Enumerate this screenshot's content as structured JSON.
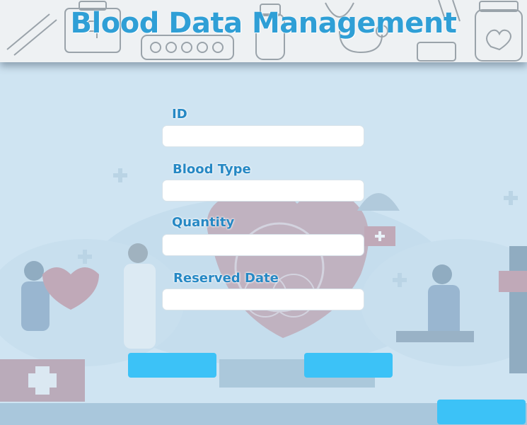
{
  "header": {
    "title": "Blood Data Management"
  },
  "form": {
    "fields": [
      {
        "label": "ID",
        "value": "",
        "placeholder": ""
      },
      {
        "label": "Blood Type",
        "value": "",
        "placeholder": ""
      },
      {
        "label": "Quantity",
        "value": "",
        "placeholder": ""
      },
      {
        "label": "Reserved Date",
        "value": "",
        "placeholder": ""
      }
    ]
  },
  "buttons": {
    "left_label": "",
    "middle_label": "",
    "corner_label": ""
  },
  "colors": {
    "title": "#2f9fd6",
    "label": "#2688c4",
    "button": "#3cc2f7",
    "background": "#cfe4f2"
  }
}
